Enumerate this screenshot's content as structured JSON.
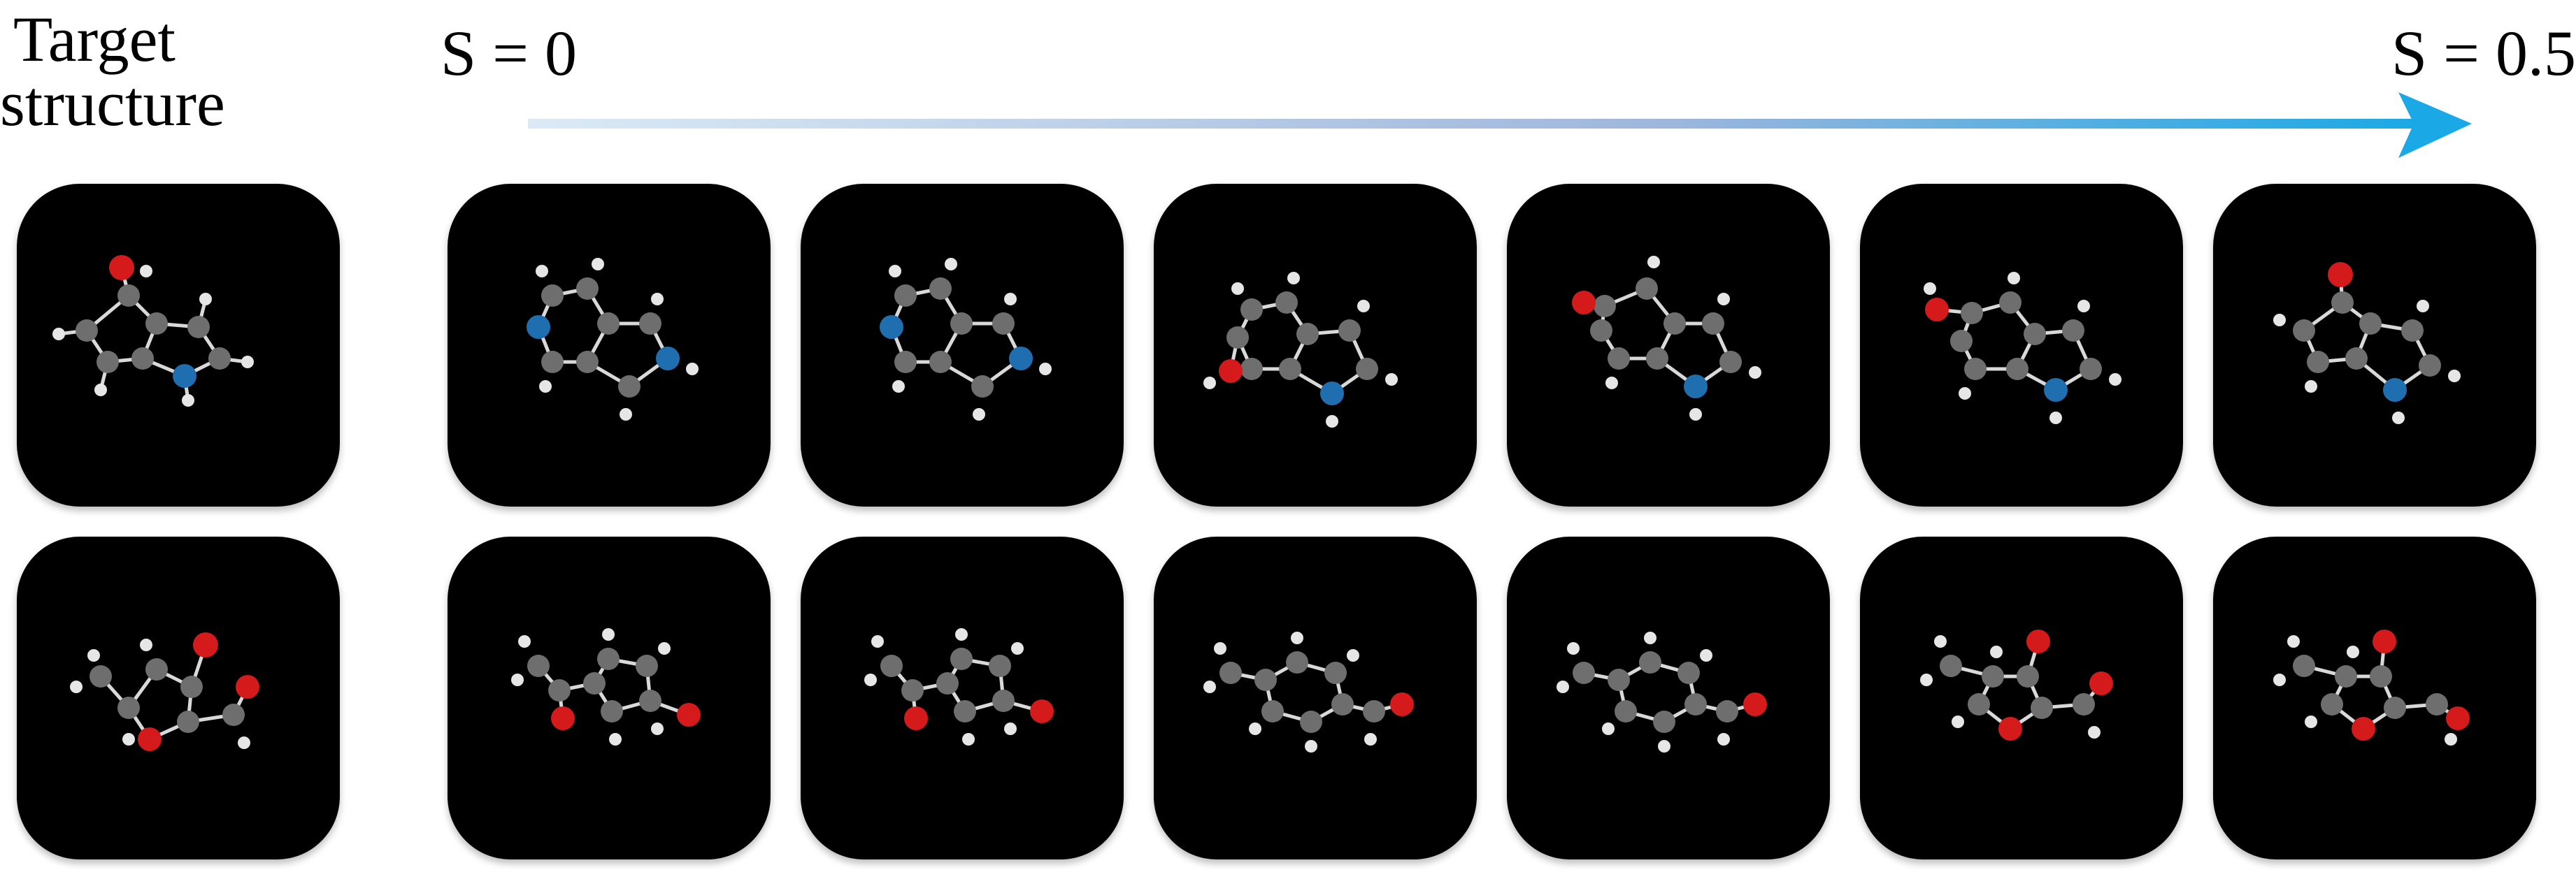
{
  "title_lines": [
    "Target",
    "structure"
  ],
  "s_start_label": "S = 0",
  "s_end_label": "S = 0.5",
  "colors": {
    "arrow_start": "#dbeaf5",
    "arrow_mid": "#9fb6dc",
    "arrow_end": "#1aa9e6",
    "carbon": "#6e6e6e",
    "hydrogen": "#e6e6e6",
    "oxygen": "#d41a1a",
    "nitrogen": "#1f6fb0",
    "tile_background": "#000000"
  },
  "rows": [
    {
      "name": "indole-series",
      "target": "indole-target",
      "sequence": [
        "indole-1",
        "indole-2",
        "indole-3",
        "indole-4",
        "indole-5",
        "indole-6"
      ]
    },
    {
      "name": "furan-series",
      "target": "furan-target",
      "sequence": [
        "furan-1",
        "furan-2",
        "benzyl-1",
        "benzyl-2",
        "furan-3",
        "furan-4"
      ]
    }
  ]
}
